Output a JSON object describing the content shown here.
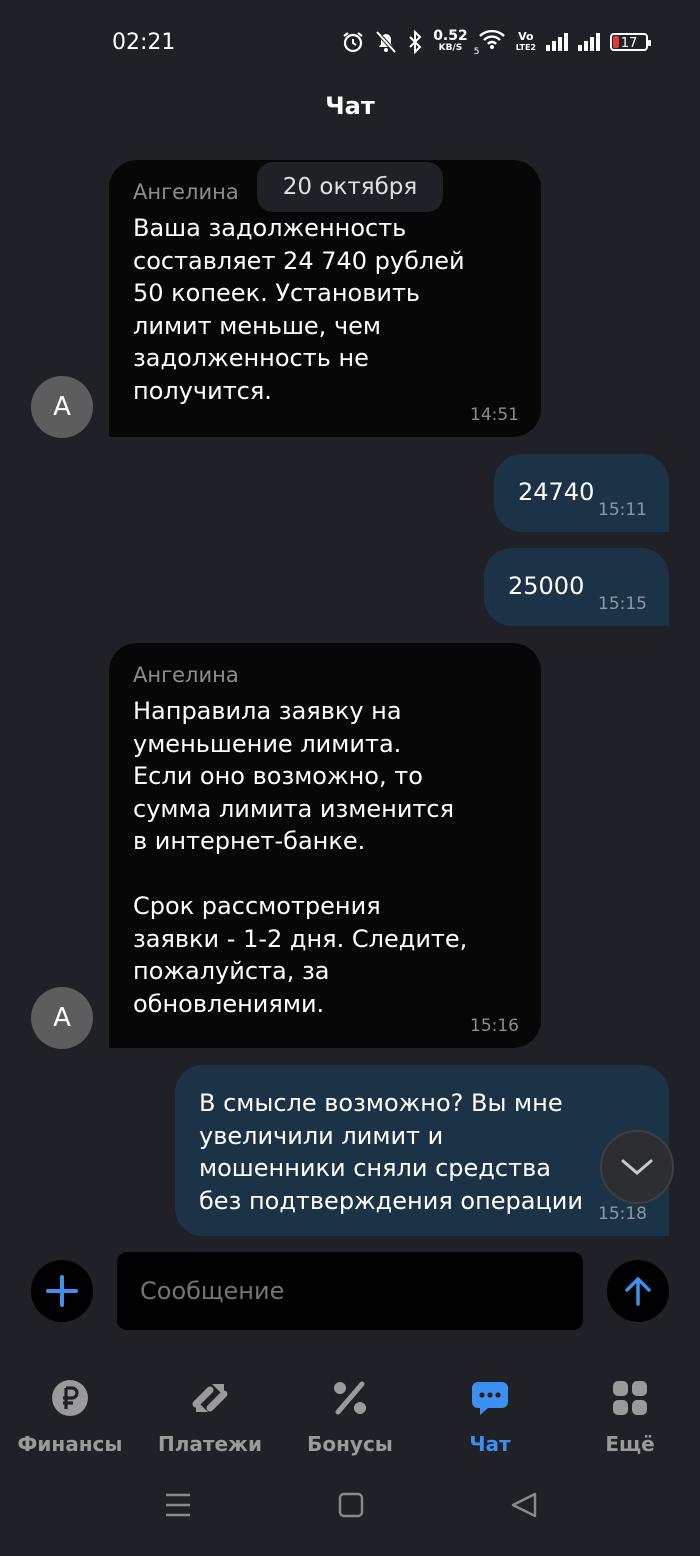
{
  "status_bar": {
    "time": "02:21",
    "net_speed_value": "0.52",
    "net_speed_unit": "KB/S",
    "wifi_sub": "5",
    "volte_top": "Vo",
    "volte_bottom": "LTE2",
    "battery": "17",
    "icons": [
      "alarm-icon",
      "mute-icon",
      "bluetooth-icon",
      "wifi-icon",
      "signal-icon",
      "signal-icon",
      "battery-icon"
    ]
  },
  "header": {
    "title": "Чат"
  },
  "chat": {
    "date_separator": "20 октября",
    "messages": [
      {
        "direction": "in",
        "sender": "Ангелина",
        "text": "Ваша задолженность\nсоставляет 24 740 рублей\n50 копеек. Установить\nлимит меньше, чем\nзадолженность не\nполучится.",
        "time": "14:51",
        "avatar": "А"
      },
      {
        "direction": "out",
        "text": "24740",
        "time": "15:11"
      },
      {
        "direction": "out",
        "text": "25000",
        "time": "15:15"
      },
      {
        "direction": "in",
        "sender": "Ангелина",
        "text": "Направила заявку на\nуменьшение лимита.\nЕсли оно возможно, то\nсумма лимита изменится\nв интернет-банке.\n\nСрок рассмотрения\nзаявки - 1-2 дня. Следите,\nпожалуйста, за\nобновлениями.",
        "time": "15:16",
        "avatar": "А"
      },
      {
        "direction": "out",
        "text": "В смысле возможно? Вы мне\nувеличили лимит и\nмошенники сняли средства\nбез подтверждения операции",
        "time": "15:18"
      }
    ]
  },
  "composer": {
    "placeholder": "Сообщение"
  },
  "bottom_nav": {
    "active": "Чат",
    "accent": "#3d8ff0",
    "items": [
      {
        "label": "Финансы",
        "icon": "ruble-icon"
      },
      {
        "label": "Платежи",
        "icon": "transfer-arrows-icon"
      },
      {
        "label": "Бонусы",
        "icon": "percent-icon"
      },
      {
        "label": "Чат",
        "icon": "chat-bubble-icon"
      },
      {
        "label": "Ещё",
        "icon": "grid-icon"
      }
    ]
  },
  "system_nav": [
    "menu-icon",
    "home-icon",
    "back-icon"
  ]
}
